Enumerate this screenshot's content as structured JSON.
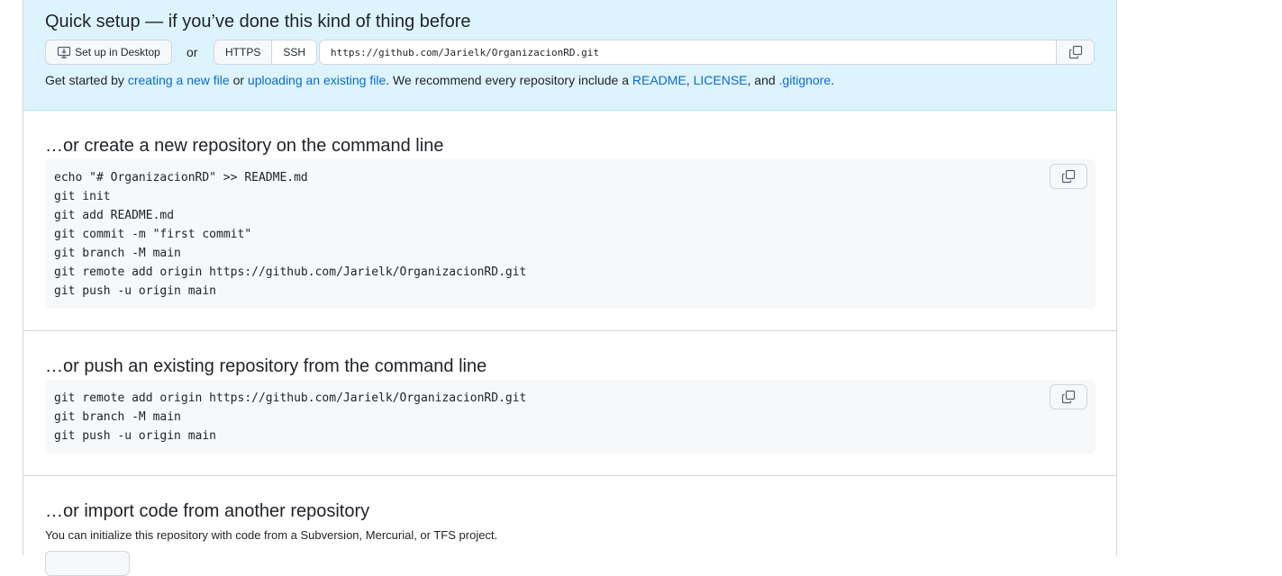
{
  "quick_setup": {
    "title": "Quick setup — if you’ve done this kind of thing before",
    "desktop_button": "Set up in Desktop",
    "or_text": "or",
    "protocol_options": [
      "HTTPS",
      "SSH"
    ],
    "selected_protocol": "HTTPS",
    "url": "https://github.com/Jarielk/OrganizacionRD.git",
    "description": {
      "prefix": "Get started by",
      "link1": "creating a new file",
      "middle1": "or",
      "link2": "uploading an existing file",
      "middle2": ". We recommend every repository include a",
      "link3": "README",
      "comma1": ",",
      "link4": "LICENSE",
      "middle3": ", and",
      "link5": ".gitignore",
      "suffix": "."
    }
  },
  "create_section": {
    "title": "…or create a new repository on the command line",
    "code": "echo \"# OrganizacionRD\" >> README.md\ngit init\ngit add README.md\ngit commit -m \"first commit\"\ngit branch -M main\ngit remote add origin https://github.com/Jarielk/OrganizacionRD.git\ngit push -u origin main"
  },
  "push_section": {
    "title": "…or push an existing repository from the command line",
    "code": "git remote add origin https://github.com/Jarielk/OrganizacionRD.git\ngit branch -M main\ngit push -u origin main"
  },
  "import_section": {
    "title": "…or import code from another repository",
    "description": "You can initialize this repository with code from a Subversion, Mercurial, or TFS project."
  },
  "icons": {
    "desktop": "desktop-download-icon",
    "copy": "copy-icon"
  }
}
